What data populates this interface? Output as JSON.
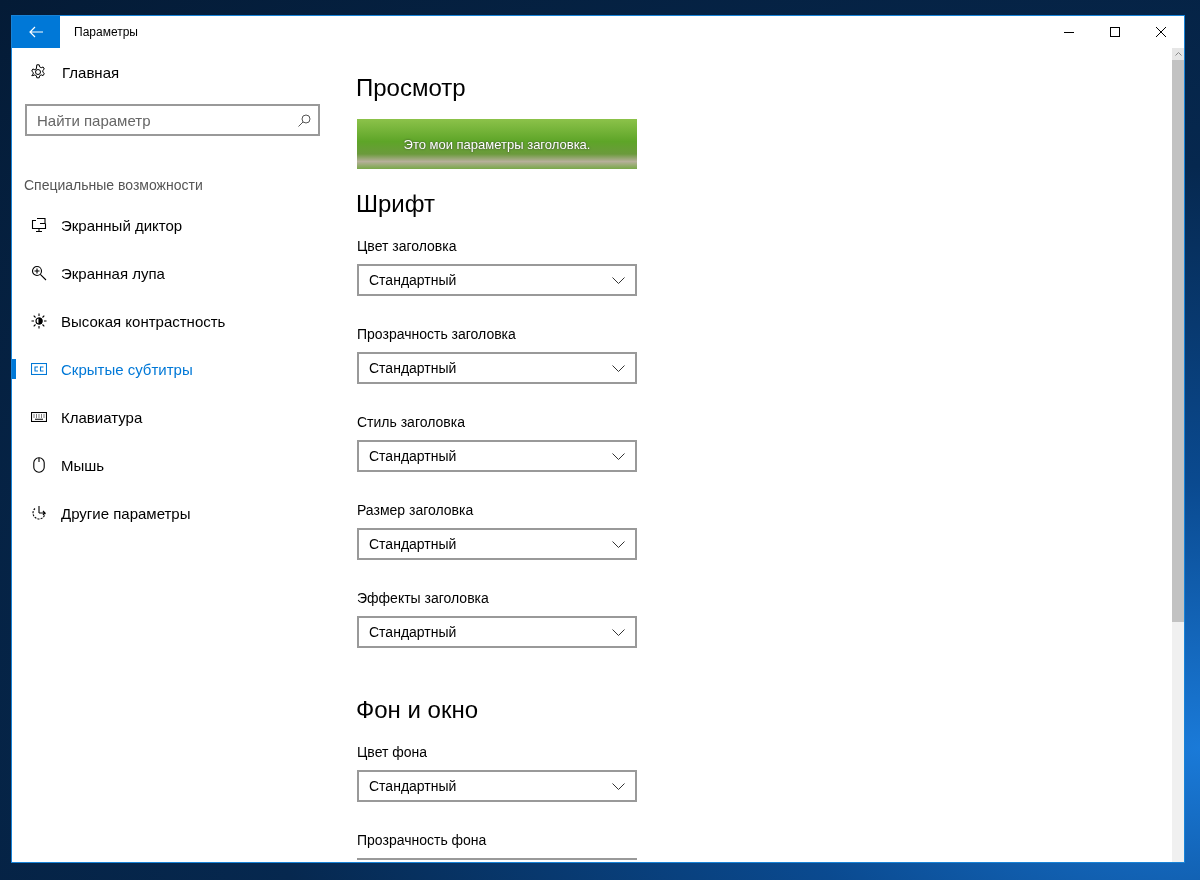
{
  "window": {
    "title": "Параметры"
  },
  "sidebar": {
    "home": "Главная",
    "search": {
      "placeholder": "Найти параметр"
    },
    "section": "Специальные возможности",
    "items": [
      {
        "label": "Экранный диктор",
        "selected": false
      },
      {
        "label": "Экранная лупа",
        "selected": false
      },
      {
        "label": "Высокая контрастность",
        "selected": false
      },
      {
        "label": "Скрытые субтитры",
        "selected": true
      },
      {
        "label": "Клавиатура",
        "selected": false
      },
      {
        "label": "Мышь",
        "selected": false
      },
      {
        "label": "Другие параметры",
        "selected": false
      }
    ]
  },
  "content": {
    "sections": [
      {
        "heading": "Просмотр",
        "kind": "preview",
        "caption": "Это мои параметры заголовка."
      },
      {
        "heading": "Шрифт",
        "kind": "settings",
        "settings": [
          {
            "label": "Цвет заголовка",
            "value": "Стандартный"
          },
          {
            "label": "Прозрачность заголовка",
            "value": "Стандартный"
          },
          {
            "label": "Стиль заголовка",
            "value": "Стандартный"
          },
          {
            "label": "Размер заголовка",
            "value": "Стандартный"
          },
          {
            "label": "Эффекты заголовка",
            "value": "Стандартный"
          }
        ]
      },
      {
        "heading": "Фон и окно",
        "kind": "settings",
        "settings": [
          {
            "label": "Цвет фона",
            "value": "Стандартный"
          },
          {
            "label": "Прозрачность фона"
          }
        ]
      }
    ]
  }
}
